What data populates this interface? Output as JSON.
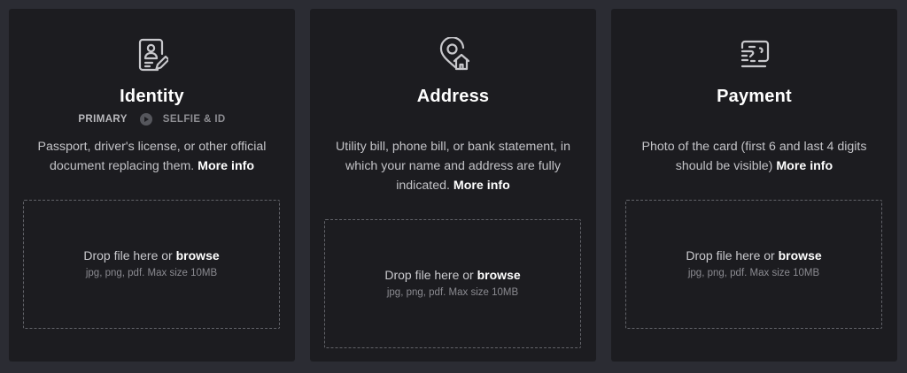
{
  "cards": [
    {
      "icon": "id-document-icon",
      "title": "Identity",
      "steps": [
        "PRIMARY",
        "SELFIE & ID"
      ],
      "description": "Passport, driver's license, or other official document replacing them.",
      "more_info": "More info",
      "drop_text": "Drop file here or",
      "browse": "browse",
      "hint": "jpg, png, pdf. Max size 10MB"
    },
    {
      "icon": "location-home-icon",
      "title": "Address",
      "description": "Utility bill, phone bill, or bank statement, in which your name and address are fully indicated.",
      "more_info": "More info",
      "drop_text": "Drop file here or",
      "browse": "browse",
      "hint": "jpg, png, pdf. Max size 10MB"
    },
    {
      "icon": "credit-card-icon",
      "title": "Payment",
      "description": "Photo of the card (first 6 and last 4 digits should be visible)",
      "more_info": "More info",
      "drop_text": "Drop file here or",
      "browse": "browse",
      "hint": "jpg, png, pdf. Max size 10MB"
    }
  ],
  "colors": {
    "background": "#2b2c33",
    "card": "#1c1c20",
    "text_muted": "#c3c3c7",
    "dashed_border": "#626369"
  }
}
